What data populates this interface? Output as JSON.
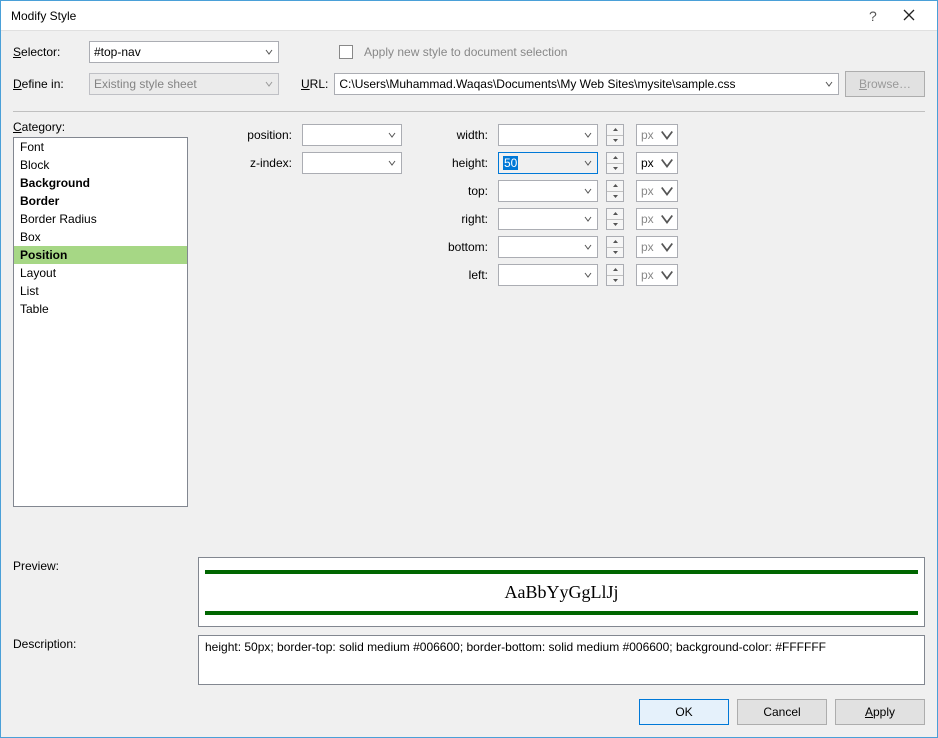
{
  "title": "Modify Style",
  "labels": {
    "selector": "Selector:",
    "define_in": "Define in:",
    "url": "URL:",
    "apply_new": "Apply new style to document selection",
    "category": "Category:",
    "preview": "Preview:",
    "description": "Description:"
  },
  "selector_value": "#top-nav",
  "define_in_value": "Existing style sheet",
  "url_value": "C:\\Users\\Muhammad.Waqas\\Documents\\My Web Sites\\mysite\\sample.css",
  "browse_label": "Browse…",
  "categories": [
    {
      "label": "Font",
      "bold": false,
      "selected": false
    },
    {
      "label": "Block",
      "bold": false,
      "selected": false
    },
    {
      "label": "Background",
      "bold": true,
      "selected": false
    },
    {
      "label": "Border",
      "bold": true,
      "selected": false
    },
    {
      "label": "Border Radius",
      "bold": false,
      "selected": false
    },
    {
      "label": "Box",
      "bold": false,
      "selected": false
    },
    {
      "label": "Position",
      "bold": true,
      "selected": true
    },
    {
      "label": "Layout",
      "bold": false,
      "selected": false
    },
    {
      "label": "List",
      "bold": false,
      "selected": false
    },
    {
      "label": "Table",
      "bold": false,
      "selected": false
    }
  ],
  "fields": {
    "position_label": "position:",
    "zindex_label": "z-index:",
    "width_label": "width:",
    "height_label": "height:",
    "top_label": "top:",
    "right_label": "right:",
    "bottom_label": "bottom:",
    "left_label": "left:",
    "height_value": "50",
    "unit": "px"
  },
  "preview_text": "AaBbYyGgLlJj",
  "description_text": "height: 50px; border-top: solid medium #006600; border-bottom: solid medium #006600; background-color: #FFFFFF",
  "buttons": {
    "ok": "OK",
    "cancel": "Cancel",
    "apply": "Apply"
  }
}
